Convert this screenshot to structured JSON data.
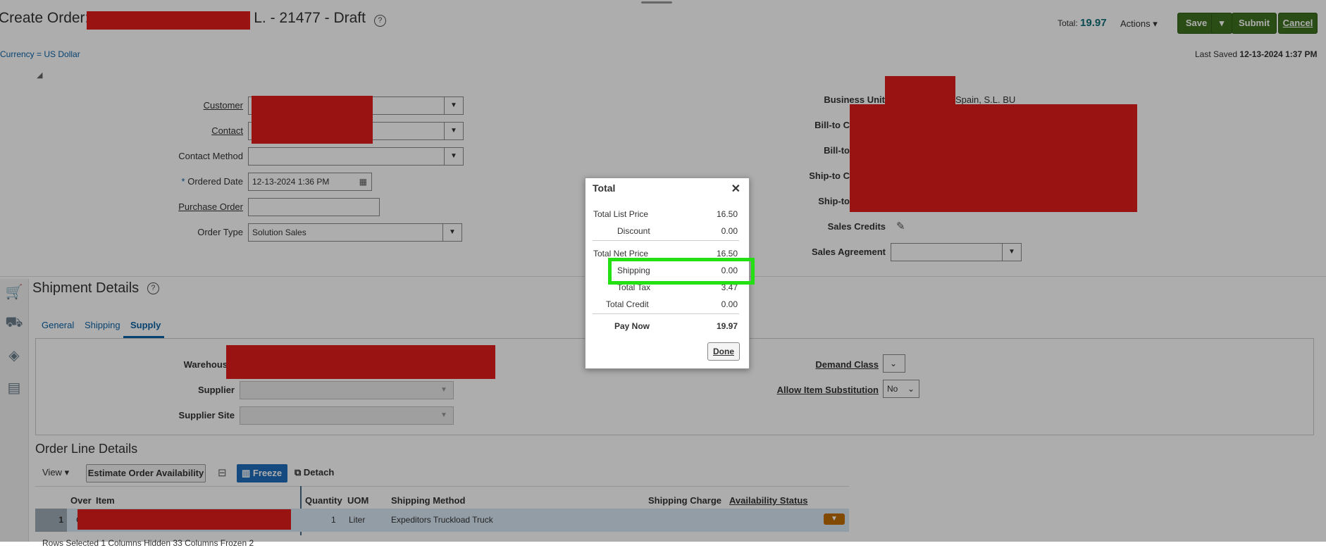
{
  "header": {
    "title_prefix": "Create Order: ",
    "title_suffix": "L. - 21477 - Draft",
    "currency": "Currency = US Dollar",
    "total_label": "Total:",
    "total_value": "19.97",
    "actions_label": "Actions",
    "save_label": "Save",
    "submit_label": "Submit",
    "cancel_label": "Cancel",
    "last_saved_label": "Last Saved",
    "last_saved_value": "12-13-2024 1:37 PM"
  },
  "form_left": {
    "customer_label": "Customer",
    "contact_label": "Contact",
    "contact_method_label": "Contact Method",
    "ordered_date_label": "Ordered Date",
    "ordered_date_value": "12-13-2024 1:36 PM",
    "purchase_order_label": "Purchase Order",
    "order_type_label": "Order Type",
    "order_type_value": "Solution Sales"
  },
  "form_right": {
    "business_unit_label": "Business Unit",
    "business_unit_value": "Spain, S.L. BU",
    "bill_to_customer_label": "Bill-to C",
    "bill_to_label": "Bill-to",
    "ship_to_customer_label": "Ship-to C",
    "ship_to_label": "Ship-to",
    "sales_credits_label": "Sales Credits",
    "sales_agreement_label": "Sales Agreement"
  },
  "shipment": {
    "title": "Shipment Details",
    "tabs": [
      "General",
      "Shipping",
      "Supply"
    ],
    "warehouse_label": "Warehous",
    "supplier_label": "Supplier",
    "supplier_site_label": "Supplier Site",
    "demand_class_label": "Demand Class",
    "allow_item_sub_label": "Allow Item Substitution",
    "allow_item_sub_value": "No"
  },
  "order_lines": {
    "title": "Order Line Details",
    "view_label": "View",
    "estimate_label": "Estimate Order Availability",
    "freeze_label": "Freeze",
    "detach_label": "Detach",
    "columns": [
      "Over",
      "Item",
      "Quantity",
      "UOM",
      "Shipping Method",
      "Shipping Charge",
      "Availability Status"
    ],
    "row": {
      "line": "1",
      "item_prefix": "C",
      "quantity": "1",
      "uom": "Liter",
      "shipping_method": "Expeditors Truckload Truck"
    },
    "footer": "Rows Selected 1   Columns Hidden 33   Columns Frozen 2"
  },
  "total_dialog": {
    "title": "Total",
    "rows": [
      {
        "label": "Total List Price",
        "value": "16.50"
      },
      {
        "label": "Discount",
        "value": "0.00"
      },
      {
        "label": "Total Net Price",
        "value": "16.50"
      },
      {
        "label": "Shipping",
        "value": "0.00"
      },
      {
        "label": "Total Tax",
        "value": "3.47"
      },
      {
        "label": "Total Credit",
        "value": "0.00"
      },
      {
        "label": "Pay Now",
        "value": "19.97"
      }
    ],
    "done_label": "Done"
  },
  "colors": {
    "brand_green": "#3f7020",
    "highlight": "#22e011",
    "redaction": "#e31c1c",
    "link_blue": "#0b62a6"
  }
}
